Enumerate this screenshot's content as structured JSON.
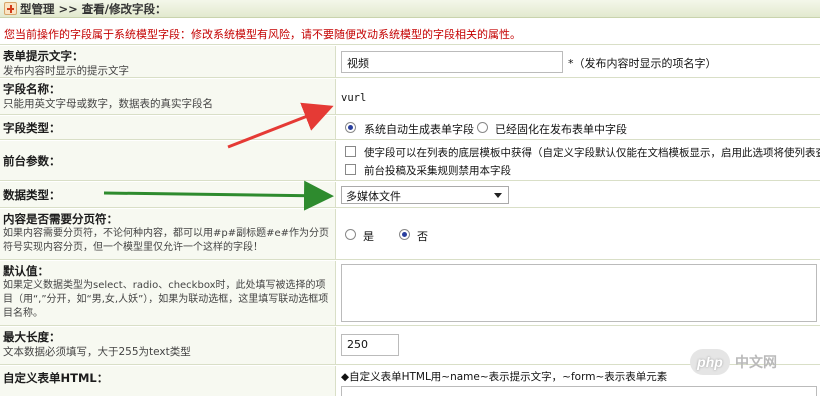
{
  "header": {
    "title": "型管理 >> 查看/修改字段：",
    "warning": "您当前操作的字段属于系统模型字段：修改系统模型有风险，请不要随便改动系统模型的字段相关的属性。"
  },
  "fields": {
    "prompt": {
      "title": "表单提示文字：",
      "desc": "发布内容时显示的提示文字",
      "value": "视频",
      "note": "*（发布内容时显示的项名字）"
    },
    "name": {
      "title": "字段名称：",
      "desc": "只能用英文字母或数字，数据表的真实字段名",
      "value": "vurl"
    },
    "field_type": {
      "title": "字段类型：",
      "options": [
        "系统自动生成表单字段",
        "已经固化在发布表单中字段"
      ],
      "selected": 0
    },
    "frontend": {
      "title": "前台参数：",
      "options": [
        "使字段可以在列表的底层模板中获得（自定义字段默认仅能在文档模板显示，启用此选项将使列表查询",
        "前台投稿及采集规则禁用本字段"
      ]
    },
    "data_type": {
      "title": "数据类型：",
      "selected": "多媒体文件"
    },
    "paging": {
      "title": "内容是否需要分页符：",
      "desc": "如果内容需要分页符，不论何种内容，都可以用#p#副标题#e#作为分页符号实现内容分页，但一个模型里仅允许一个这样的字段！",
      "options": [
        "是",
        "否"
      ],
      "selected": 1
    },
    "default": {
      "title": "默认值：",
      "desc": "如果定义数据类型为select、radio、checkbox时，此处填写被选择的项目（用“,”分开，如“男,女,人妖”），如果为联动选框，这里填写联动选框项目名称。"
    },
    "max_length": {
      "title": "最大长度：",
      "desc": "文本数据必须填写，大于255为text类型",
      "value": "250"
    },
    "custom_html": {
      "title": "自定义表单HTML：",
      "note": "◆自定义表单HTML用~name~表示提示文字，~form~表示表单元素"
    }
  },
  "watermark": {
    "logo": "php",
    "text": "中文网"
  },
  "colors": {
    "warning_text": "#c40000",
    "label_bg": "#f7f9f1",
    "red_arrow": "#e53a35",
    "green_arrow": "#2e8b2e"
  }
}
